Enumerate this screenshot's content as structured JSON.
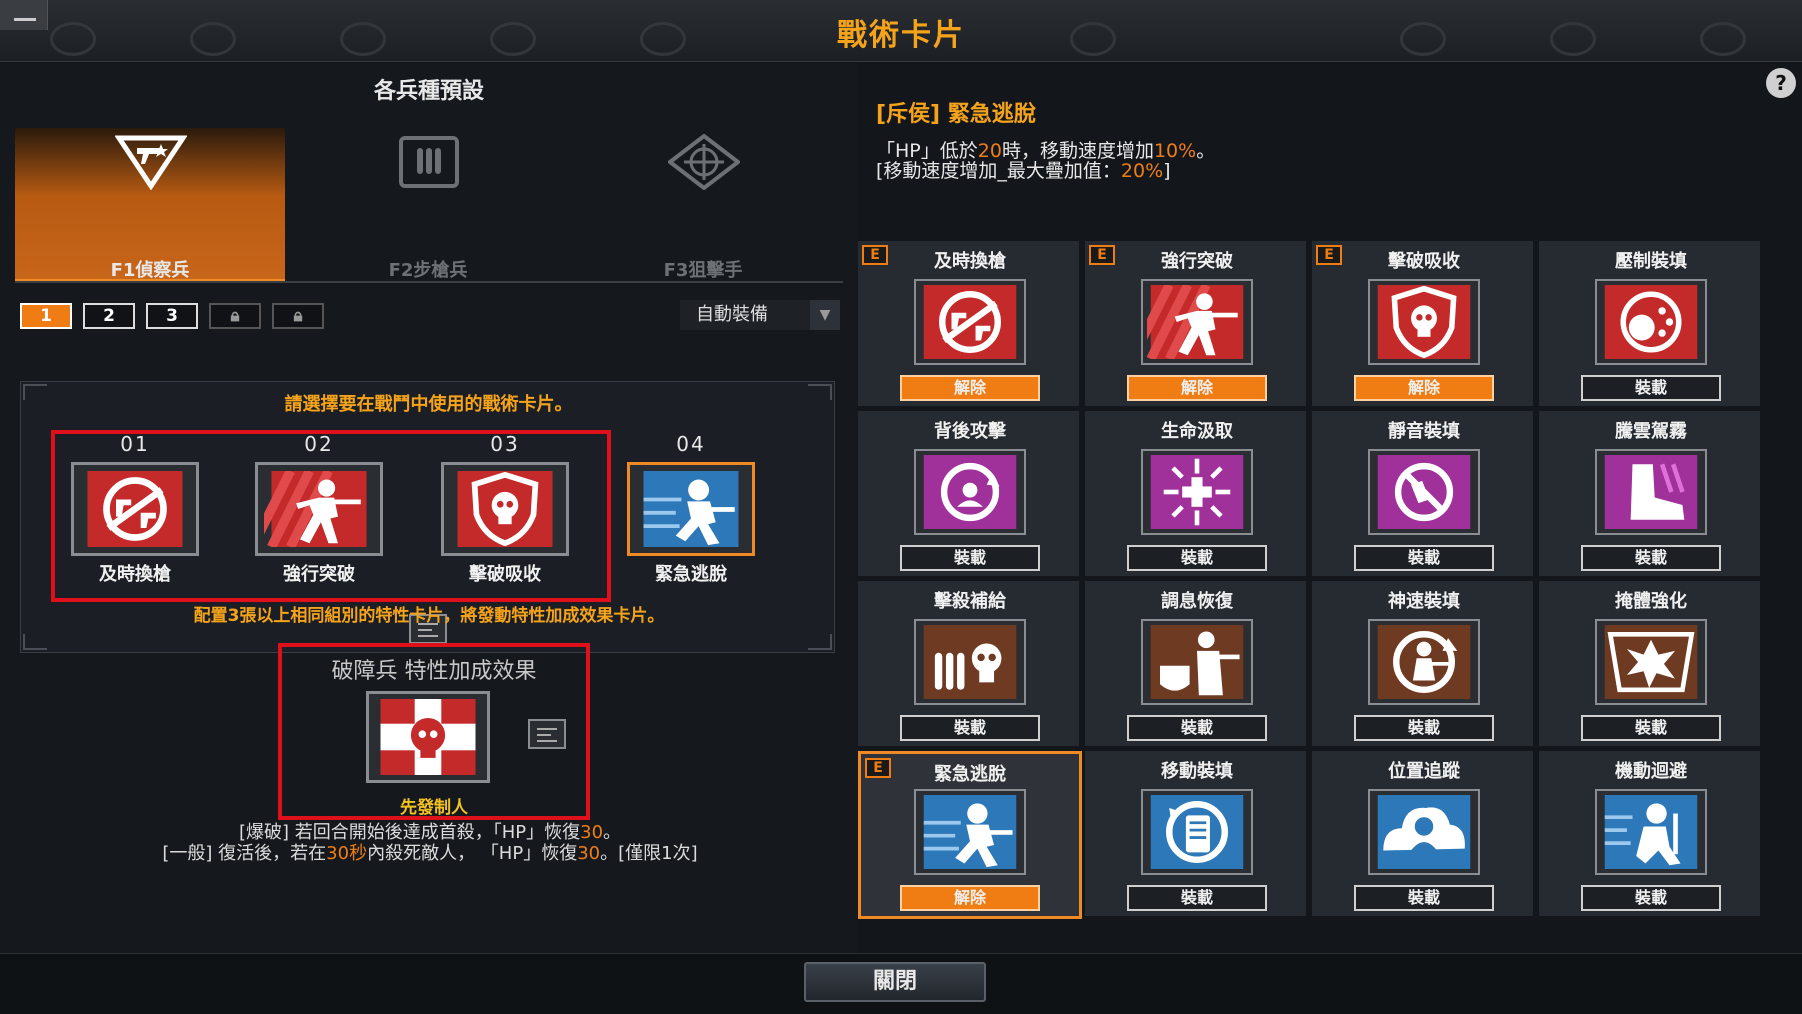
{
  "window": {
    "title": "戰術卡片"
  },
  "left": {
    "section_title": "各兵種預設",
    "class_tabs": [
      {
        "label": "F1偵察兵",
        "active": true
      },
      {
        "label": "F2步槍兵",
        "active": false
      },
      {
        "label": "F3狙擊手",
        "active": false
      }
    ],
    "presets": [
      "1",
      "2",
      "3"
    ],
    "auto_equip_label": "自動裝備",
    "select_prompt": "請選擇要在戰鬥中使用的戰術卡片。",
    "slots": [
      {
        "num": "01",
        "label": "及時換槍"
      },
      {
        "num": "02",
        "label": "強行突破"
      },
      {
        "num": "03",
        "label": "擊破吸收"
      },
      {
        "num": "04",
        "label": "緊急逃脫"
      }
    ],
    "notice": "配置3張以上相同組別的特性卡片，將發動特性加成效果卡片。",
    "bonus": {
      "title": "破障兵  特性加成效果",
      "name": "先發制人",
      "line1_a": "[爆破] 若回合開始後達成首殺，「HP」恢復",
      "line1_b": "30",
      "line1_c": "。",
      "line2_a": "[一般] 復活後，若在",
      "line2_b": "30秒",
      "line2_c": "內殺死敵人，  「HP」恢復",
      "line2_d": "30",
      "line2_e": "。[僅限1次]"
    }
  },
  "detail": {
    "title": "[斥侯] 緊急逃脫",
    "line1_a": "「HP」低於",
    "line1_b": "20",
    "line1_c": "時，移動速度增加",
    "line1_d": "10%",
    "line1_e": "。",
    "line2_a": "[移動速度增加_最大疊加值：",
    "line2_b": "20%",
    "line2_c": "]"
  },
  "cards": [
    {
      "name": "及時換槍",
      "button": "解除",
      "equipped": true,
      "badge": "E"
    },
    {
      "name": "強行突破",
      "button": "解除",
      "equipped": true,
      "badge": "E"
    },
    {
      "name": "擊破吸收",
      "button": "解除",
      "equipped": true,
      "badge": "E"
    },
    {
      "name": "壓制裝填",
      "button": "裝載",
      "equipped": false
    },
    {
      "name": "背後攻擊",
      "button": "裝載",
      "equipped": false
    },
    {
      "name": "生命汲取",
      "button": "裝載",
      "equipped": false
    },
    {
      "name": "靜音裝填",
      "button": "裝載",
      "equipped": false
    },
    {
      "name": "騰雲駕霧",
      "button": "裝載",
      "equipped": false
    },
    {
      "name": "擊殺補給",
      "button": "裝載",
      "equipped": false
    },
    {
      "name": "調息恢復",
      "button": "裝載",
      "equipped": false
    },
    {
      "name": "神速裝填",
      "button": "裝載",
      "equipped": false
    },
    {
      "name": "掩體強化",
      "button": "裝載",
      "equipped": false
    },
    {
      "name": "緊急逃脫",
      "button": "解除",
      "equipped": true,
      "badge": "E",
      "selected": true
    },
    {
      "name": "移動裝填",
      "button": "裝載",
      "equipped": false
    },
    {
      "name": "位置追蹤",
      "button": "裝載",
      "equipped": false
    },
    {
      "name": "機動迴避",
      "button": "裝載",
      "equipped": false
    }
  ],
  "close_label": "關閉",
  "colors": {
    "accent": "#f07d14",
    "title": "#f5a31a",
    "red_frame": "#e0101a"
  }
}
